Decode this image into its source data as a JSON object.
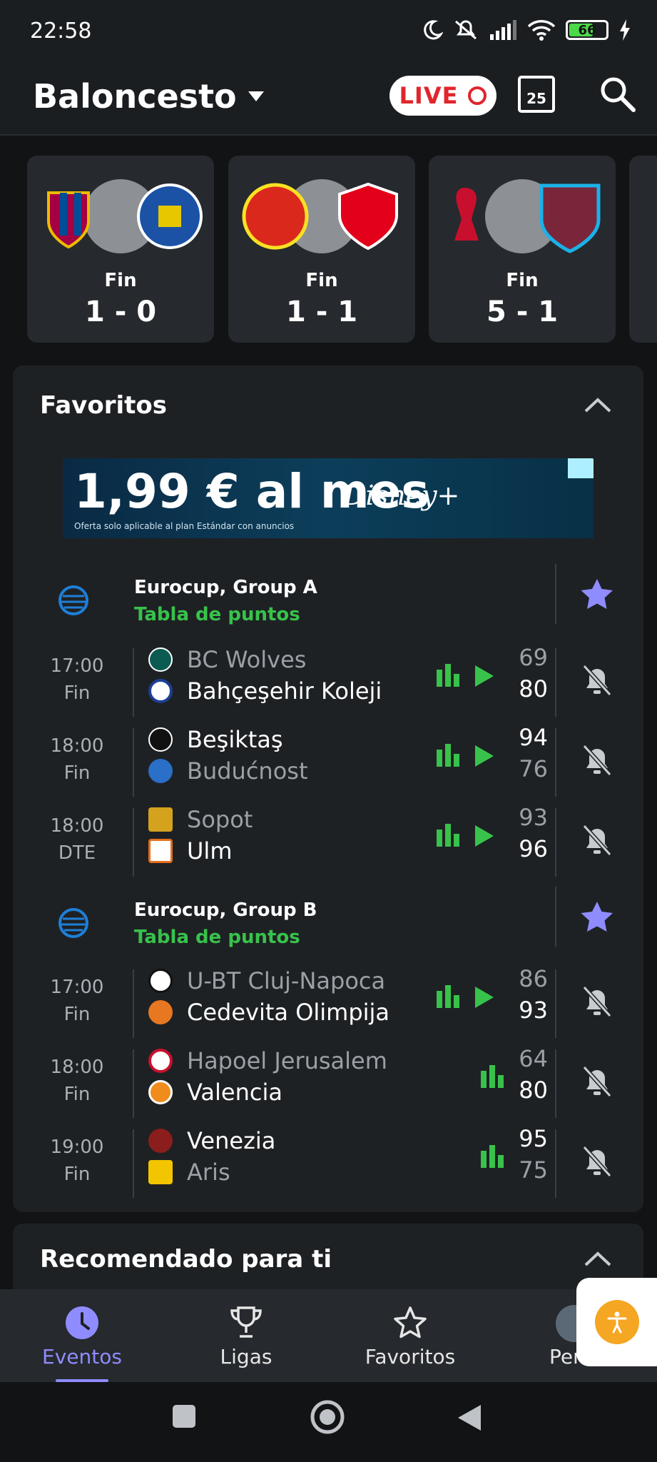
{
  "status": {
    "time": "22:58",
    "battery": "66"
  },
  "header": {
    "title": "Baloncesto",
    "live_label": "LIVE",
    "calendar_day": "25"
  },
  "cards": [
    {
      "status": "Fin",
      "score": "1 - 0"
    },
    {
      "status": "Fin",
      "score": "1 - 1"
    },
    {
      "status": "Fin",
      "score": "5 - 1"
    }
  ],
  "favorites": {
    "title": "Favoritos",
    "ad": {
      "price": "1,99 € al mes",
      "note": "Oferta solo aplicable al plan Estándar con anuncios",
      "brand": "Disney+"
    },
    "leagues": [
      {
        "name": "Eurocup, Group A",
        "link": "Tabla de puntos",
        "matches": [
          {
            "time": "17:00",
            "status": "Fin",
            "home": "BC Wolves",
            "away": "Bahçeşehir Koleji",
            "home_score": "69",
            "away_score": "80"
          },
          {
            "time": "18:00",
            "status": "Fin",
            "home": "Beşiktaş",
            "away": "Budućnost",
            "home_score": "94",
            "away_score": "76"
          },
          {
            "time": "18:00",
            "status": "DTE",
            "home": "Sopot",
            "away": "Ulm",
            "home_score": "93",
            "away_score": "96"
          }
        ]
      },
      {
        "name": "Eurocup, Group B",
        "link": "Tabla de puntos",
        "matches": [
          {
            "time": "17:00",
            "status": "Fin",
            "home": "U-BT Cluj-Napoca",
            "away": "Cedevita Olimpija",
            "home_score": "86",
            "away_score": "93"
          },
          {
            "time": "18:00",
            "status": "Fin",
            "home": "Hapoel Jerusalem",
            "away": "Valencia",
            "home_score": "64",
            "away_score": "80"
          },
          {
            "time": "19:00",
            "status": "Fin",
            "home": "Venezia",
            "away": "Aris",
            "home_score": "95",
            "away_score": "75"
          }
        ]
      }
    ]
  },
  "recommended": {
    "title": "Recomendado para ti"
  },
  "nav": {
    "events": "Eventos",
    "leagues": "Ligas",
    "favorites": "Favoritos",
    "profile": "Perfil"
  },
  "colors": {
    "accent": "#8f8cff",
    "green": "#38c24b",
    "live_red": "#e0262c"
  }
}
